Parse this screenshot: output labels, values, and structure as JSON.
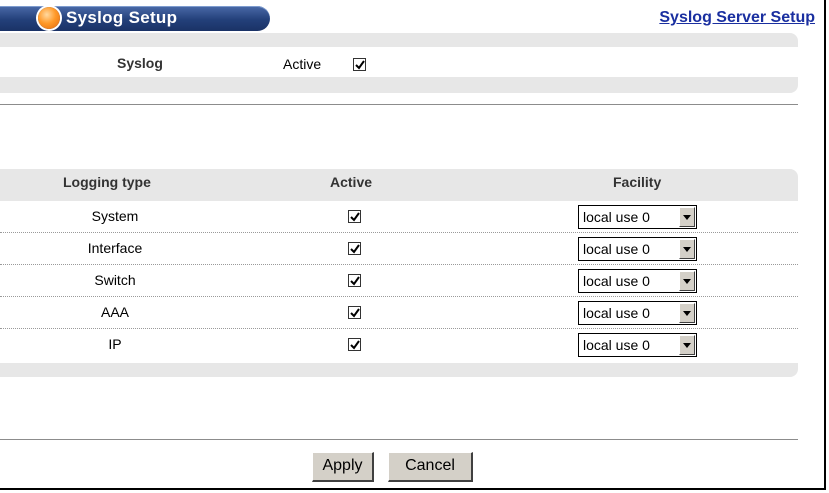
{
  "header": {
    "title": "Syslog Setup",
    "server_link": "Syslog Server Setup"
  },
  "syslog": {
    "label": "Syslog",
    "active_label": "Active",
    "active_checked": true
  },
  "logging_table": {
    "columns": [
      "Logging type",
      "Active",
      "Facility"
    ],
    "rows": [
      {
        "type": "System",
        "active": true,
        "facility": "local use 0"
      },
      {
        "type": "Interface",
        "active": true,
        "facility": "local use 0"
      },
      {
        "type": "Switch",
        "active": true,
        "facility": "local use 0"
      },
      {
        "type": "AAA",
        "active": true,
        "facility": "local use 0"
      },
      {
        "type": "IP",
        "active": true,
        "facility": "local use 0"
      }
    ]
  },
  "buttons": {
    "apply": "Apply",
    "cancel": "Cancel"
  },
  "colors": {
    "title_bar": "#23407a",
    "link": "#1a2fa0",
    "panel_bg": "#e7e7e7"
  }
}
